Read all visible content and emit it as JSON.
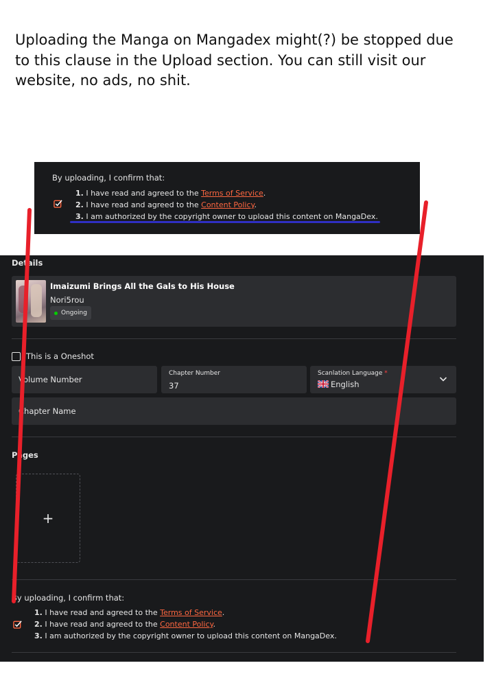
{
  "caption": "Uploading the Manga on Mangadex might(?) be stopped due to this clause in the Upload section. You can still visit our website, no ads, no shit.",
  "confirm": {
    "intro": "By uploading, I confirm that:",
    "items": [
      {
        "num": "1.",
        "prefix": "I have read and agreed to the ",
        "link": "Terms of Service",
        "suffix": "."
      },
      {
        "num": "2.",
        "prefix": "I have read and agreed to the ",
        "link": "Content Policy",
        "suffix": "."
      },
      {
        "num": "3.",
        "prefix": "I am authorized by the copyright owner to upload this content on MangaDex.",
        "link": "",
        "suffix": ""
      }
    ],
    "checked": true
  },
  "details": {
    "section_title": "Details",
    "manga": {
      "title": "Imaizumi Brings All the Gals to His House",
      "author": "Nori5rou",
      "status": "Ongoing",
      "status_color": "#04d000"
    },
    "oneshot_label": "This is a Oneshot",
    "oneshot_checked": false,
    "volume_placeholder": "Volume Number",
    "chapter_number_label": "Chapter Number",
    "chapter_number_value": "37",
    "language_label": "Scanlation Language",
    "language_required_mark": "*",
    "language_value": "English",
    "chapter_name_placeholder": "Chapter Name"
  },
  "pages": {
    "section_title": "Pages",
    "add_symbol": "+"
  },
  "colors": {
    "panel_bg": "#191a1c",
    "field_bg": "#2c2d30",
    "link": "#ff6740",
    "annotation_red": "#e8202a",
    "annotation_blue": "#2f2fc4"
  }
}
